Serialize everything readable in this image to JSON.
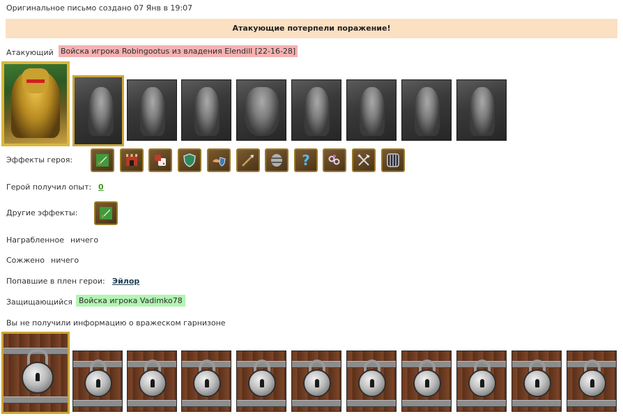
{
  "header": {
    "original_letter": "Оригинальное письмо создано 07 Янв в 19:07"
  },
  "battle": {
    "result_banner": "Атакующие потерпели поражение!",
    "attacker_label": "Атакующий",
    "attacker_value": "Войска игрока Robingootus из владения Elendill [22-16-28]",
    "hero_effects_label": "Эффекты героя:",
    "hero_exp_label": "Герой получил опыт:",
    "hero_exp_value": "0",
    "other_effects_label": "Другие эффекты:",
    "loot_label": "Награбленное",
    "loot_value": "ничего",
    "burned_label": "Сожжено",
    "burned_value": "ничего",
    "captured_label": "Попавшие в плен герои:",
    "captured_value": "Эйлор",
    "defender_label": "Защищающийся",
    "defender_value": "Войска игрока Vadimko78",
    "no_info_text": "Вы не получили информацию о вражеском гарнизоне"
  },
  "attacker_units": [
    {
      "icon": "dwarf-unit-icon"
    },
    {
      "icon": "armored-knight-unit-icon"
    },
    {
      "icon": "centurion-unit-icon"
    },
    {
      "icon": "griffin-unit-icon"
    },
    {
      "icon": "archer-unit-icon"
    },
    {
      "icon": "staff-mage-unit-icon"
    },
    {
      "icon": "hooded-monk-unit-icon"
    },
    {
      "icon": "druid-mage-unit-icon"
    }
  ],
  "hero_effects": [
    {
      "icon": "sword-icon"
    },
    {
      "icon": "castle-gate-icon"
    },
    {
      "icon": "dice-icon"
    },
    {
      "icon": "green-shield-icon"
    },
    {
      "icon": "hand-shield-icon"
    },
    {
      "icon": "spear-icon"
    },
    {
      "icon": "barrel-icon"
    },
    {
      "icon": "question-mark-icon",
      "glyph": "?"
    },
    {
      "icon": "chains-icon"
    },
    {
      "icon": "crossed-axes-icon"
    },
    {
      "icon": "iron-gate-icon"
    }
  ],
  "other_effects": [
    {
      "icon": "sword-icon"
    }
  ],
  "colors": {
    "banner_bg": "#fbe0c2",
    "attacker_highlight": "#f5b2b2",
    "defender_highlight": "#b2f5b2",
    "exp_link": "#3a9a1a",
    "captured_link": "#1b3e55",
    "slot_frame_gold": "#c9a63a"
  }
}
